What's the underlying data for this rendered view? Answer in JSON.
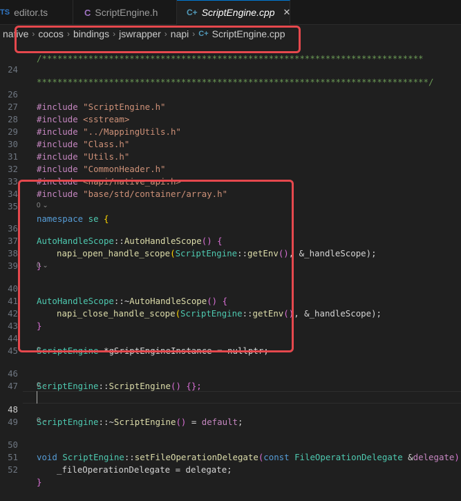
{
  "tabs": [
    {
      "icon": "TS",
      "label": "editor.ts",
      "active": false
    },
    {
      "icon": "C",
      "label": "ScriptEngine.h",
      "active": false
    },
    {
      "icon": "C+",
      "label": "ScriptEngine.cpp",
      "active": true,
      "close": "✕"
    }
  ],
  "breadcrumb": [
    "native",
    "cocos",
    "bindings",
    "jswrapper",
    "napi",
    "ScriptEngine.cpp"
  ],
  "breadcrumb_sep": "›",
  "codelens": "0 ⌄",
  "line_numbers": [
    "24",
    "26",
    "27",
    "28",
    "29",
    "30",
    "31",
    "32",
    "33",
    "34",
    "35",
    "36",
    "37",
    "38",
    "39",
    "40",
    "41",
    "42",
    "43",
    "44",
    "45",
    "46",
    "47",
    "48",
    "49",
    "50",
    "51",
    "52"
  ],
  "code": {
    "stars_top": "/**************************************************************************",
    "stars_24": "****************************************************************************/",
    "include": "#include",
    "inc_26": "\"ScriptEngine.h\"",
    "inc_27": "<sstream>",
    "inc_28": "\"../MappingUtils.h\"",
    "inc_29": "\"Class.h\"",
    "inc_30": "\"Utils.h\"",
    "inc_31": "\"CommonHeader.h\"",
    "inc_32": "<napi/native_api.h>",
    "inc_33": "\"base/std/container/array.h\"",
    "namespace": "namespace",
    "ns_name": "se",
    "brace_open": "{",
    "brace_close": "}",
    "class_ahs": "AutoHandleScope",
    "scope_op": "::",
    "tilde": "~",
    "parens": "()",
    "open_fn": "napi_open_handle_scope",
    "close_fn": "napi_close_handle_scope",
    "script_engine": "ScriptEngine",
    "get_env": "getEnv",
    "handle_arg": ", &_handleScope);",
    "ptr_decl": " *gSriptEngineInstance = nullptr;",
    "ctor_tail": " {};",
    "eq": " = ",
    "default_kw": "default",
    "semi": ";",
    "void_kw": "void",
    "set_delegate": "setFileOperationDelegate",
    "const_kw": "const",
    "delegate_type": "FileOperationDelegate",
    "amp": " &",
    "delegate_param": "delegate",
    "close_paren": ")",
    "assign_51": "_fileOperationDelegate = delegate;"
  }
}
